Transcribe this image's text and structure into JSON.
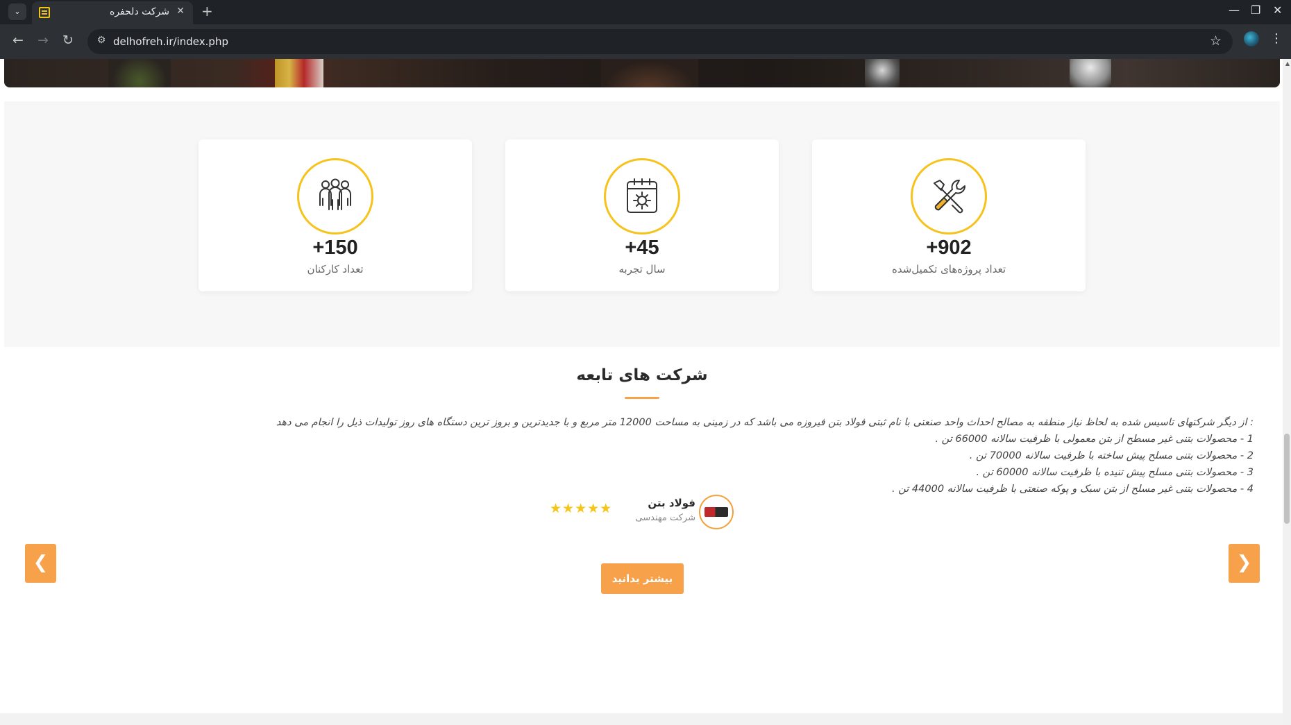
{
  "browser": {
    "tab_title": "شرکت دلحفره",
    "url": "delhofreh.ir/index.php",
    "tab_list_icon": "chevron-down-icon",
    "new_tab": "+",
    "close_tab": "✕"
  },
  "stats": [
    {
      "number": "+902",
      "label": "تعداد پروژه‌های تکمیل‌شده",
      "icon": "tools-icon"
    },
    {
      "number": "+45",
      "label": "سال تجربه",
      "icon": "calendar-gear-icon"
    },
    {
      "number": "+150",
      "label": "تعداد کارکنان",
      "icon": "team-icon"
    }
  ],
  "subsidiaries": {
    "title": "شرکت های تابعه",
    "description_lines": [
      ": از دیگر شرکتهای تاسیس شده به لحاظ نیاز منطقه به مصالح احداث واحد صنعتی با نام ثبتی فولاد بتن فیروزه می باشد که در زمینی به مساحت 12000 متر مربع و با جدیدترین و بروز ترین دستگاه های روز تولیدات ذیل را انجام می دهد",
      "1 - محصولات بتنی غیر مسطح از بتن معمولی با ظرفیت سالانه 66000 تن .",
      "2 - محصولات بتنی مسلح پیش ساخته با ظرفیت سالانه 70000 تن .",
      "3 - محصولات بتنی مسلح پیش تنیده با ظرفیت سالانه 60000 تن .",
      "4 - محصولات بتنی غیر مسلح از بتن سبک و پوکه صنعتی با ظرفیت سالانه 44000 تن ."
    ],
    "company_name": "فولاد بتن",
    "company_type": "شرکت مهندسی",
    "rating": 5,
    "stars_text": "★★★★★",
    "more_button": "بیشتر بدانید",
    "prev_arrow": "❮",
    "next_arrow": "❯"
  },
  "colors": {
    "accent": "#f7a14b",
    "icon_ring": "#f6c21c",
    "star": "#f5c518"
  }
}
